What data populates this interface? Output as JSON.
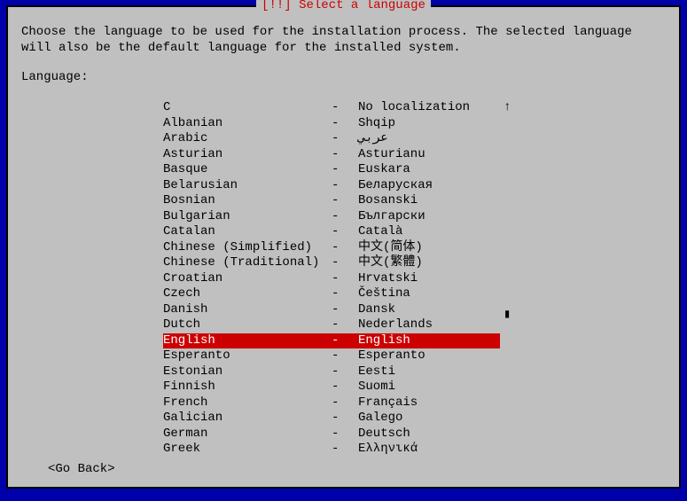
{
  "dialog": {
    "title": "[!!] Select a language",
    "intro": "Choose the language to be used for the installation process. The selected language will also be the default language for the installed system.",
    "label": "Language:",
    "goBack": "<Go Back>"
  },
  "scroll": {
    "up": "↑",
    "thumb": "▮"
  },
  "languages": [
    {
      "name": "C",
      "native": "No localization",
      "selected": false
    },
    {
      "name": "Albanian",
      "native": "Shqip",
      "selected": false
    },
    {
      "name": "Arabic",
      "native": "عربي",
      "selected": false
    },
    {
      "name": "Asturian",
      "native": "Asturianu",
      "selected": false
    },
    {
      "name": "Basque",
      "native": "Euskara",
      "selected": false
    },
    {
      "name": "Belarusian",
      "native": "Беларуская",
      "selected": false
    },
    {
      "name": "Bosnian",
      "native": "Bosanski",
      "selected": false
    },
    {
      "name": "Bulgarian",
      "native": "Български",
      "selected": false
    },
    {
      "name": "Catalan",
      "native": "Català",
      "selected": false
    },
    {
      "name": "Chinese (Simplified)",
      "native": "中文(简体)",
      "selected": false
    },
    {
      "name": "Chinese (Traditional)",
      "native": "中文(繁體)",
      "selected": false
    },
    {
      "name": "Croatian",
      "native": "Hrvatski",
      "selected": false
    },
    {
      "name": "Czech",
      "native": "Čeština",
      "selected": false
    },
    {
      "name": "Danish",
      "native": "Dansk",
      "selected": false
    },
    {
      "name": "Dutch",
      "native": "Nederlands",
      "selected": false
    },
    {
      "name": "English",
      "native": "English",
      "selected": true
    },
    {
      "name": "Esperanto",
      "native": "Esperanto",
      "selected": false
    },
    {
      "name": "Estonian",
      "native": "Eesti",
      "selected": false
    },
    {
      "name": "Finnish",
      "native": "Suomi",
      "selected": false
    },
    {
      "name": "French",
      "native": "Français",
      "selected": false
    },
    {
      "name": "Galician",
      "native": "Galego",
      "selected": false
    },
    {
      "name": "German",
      "native": "Deutsch",
      "selected": false
    },
    {
      "name": "Greek",
      "native": "Ελληνικά",
      "selected": false
    }
  ]
}
